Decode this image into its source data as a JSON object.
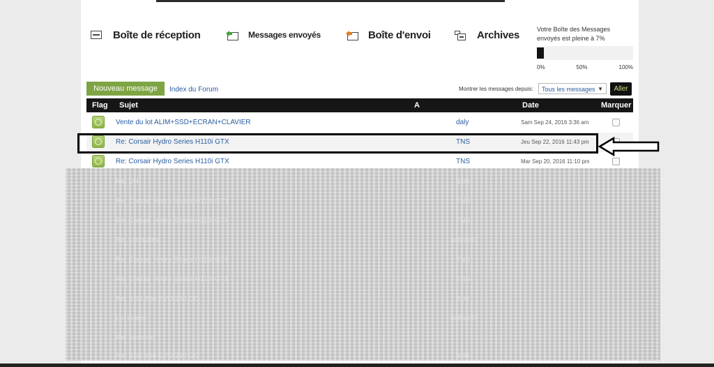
{
  "folders": {
    "inbox": "Boîte de réception",
    "sent": "Messages envoyés",
    "outbox": "Boîte d'envoi",
    "archives": "Archives"
  },
  "quota": {
    "text": "Votre Boîte des Messages envoyés est pleine à 7%",
    "percent": 7,
    "scale": [
      "0%",
      "50%",
      "100%"
    ]
  },
  "toolbar": {
    "new_message": "Nouveau message",
    "forum_index": "Index du Forum",
    "show_since": "Montrer les messages depuis:",
    "since_value": "Tous les messages",
    "go": "Aller"
  },
  "table": {
    "headers": {
      "flag": "Flag",
      "subject": "Sujet",
      "to": "A",
      "date": "Date",
      "mark": "Marquer"
    },
    "rows": [
      {
        "subject": "Vente du lot ALIM+SSD+ECRAN+CLAVIER",
        "author": "daly",
        "date": "Sam Sep 24, 2016 3:36 am"
      },
      {
        "subject": "Re: Corsair Hydro Series H110i GTX",
        "author": "TNS",
        "date": "Jeu Sep 22, 2016 11:43 pm"
      },
      {
        "subject": "Re: Corsair Hydro Series H110i GTX",
        "author": "TNS",
        "date": "Mar Sep 20, 2016 11:10 pm"
      }
    ],
    "obscured_rows": [
      {
        "subject": "Re: DH",
        "author": "BzH"
      },
      {
        "subject": "Re: Corsair Hydro Series H110i GTX",
        "author": "TNS"
      },
      {
        "subject": "Re: Corsair Hydro Series H110i GTX",
        "author": "TNS"
      },
      {
        "subject": "Re: Lot mates",
        "author": "nofear87"
      },
      {
        "subject": "Re: Corsair Hydro Series H110i GTX",
        "author": "TNS"
      },
      {
        "subject": "Re: Corsair Hydro Series H110i GTX",
        "author": "TNS"
      },
      {
        "subject": "Re: SSD 850 EVO 250 GO",
        "author": "BzH"
      },
      {
        "subject": "Lot mates",
        "author": "nofear87"
      },
      {
        "subject": "Re: livraison",
        "author": ""
      },
      {
        "subject": "Re: SSD 850 EVO 250 GO",
        "author": "BzH"
      }
    ]
  },
  "colors": {
    "accent": "#7ea444",
    "link": "#2a5d9f",
    "header": "#161616"
  }
}
